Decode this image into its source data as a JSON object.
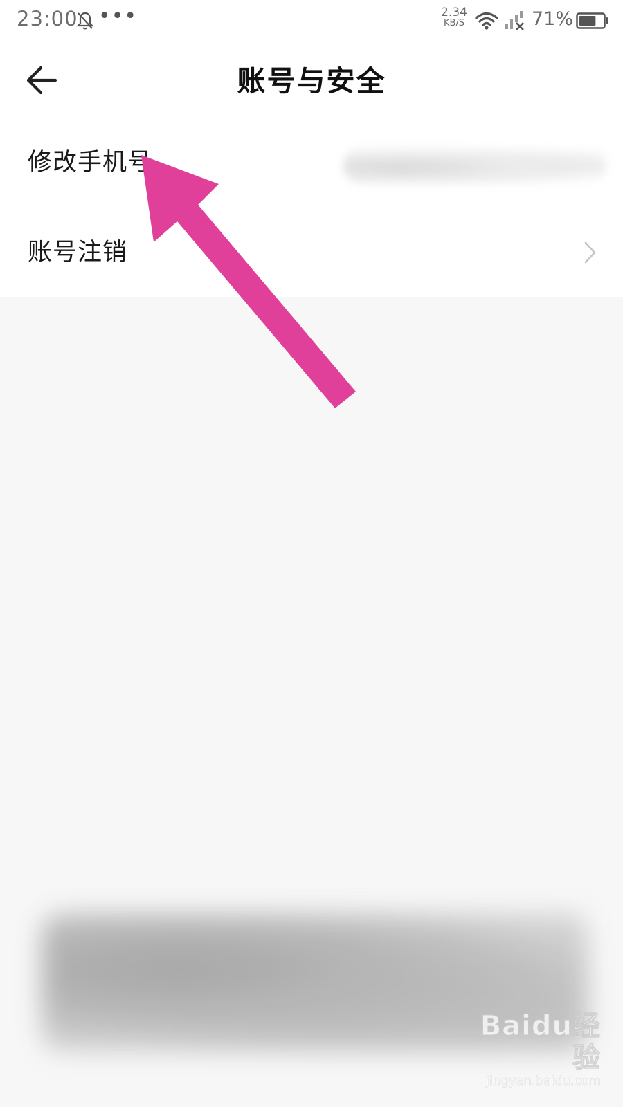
{
  "status_bar": {
    "time": "23:00",
    "more_dots": "•••",
    "net_speed_value": "2.34",
    "net_speed_unit": "KB/S",
    "battery_percent": "71%",
    "battery_level": 0.71
  },
  "header": {
    "title": "账号与安全"
  },
  "menu": {
    "items": [
      {
        "label": "修改手机号"
      },
      {
        "label": "账号注销"
      }
    ]
  },
  "annotation": {
    "color": "#e0409a"
  },
  "watermark": {
    "main": "Baidu经验",
    "sub": "jingyan.baidu.com"
  },
  "colors": {
    "background": "#f7f7f7",
    "surface": "#ffffff",
    "divider": "#dcdcdc"
  }
}
